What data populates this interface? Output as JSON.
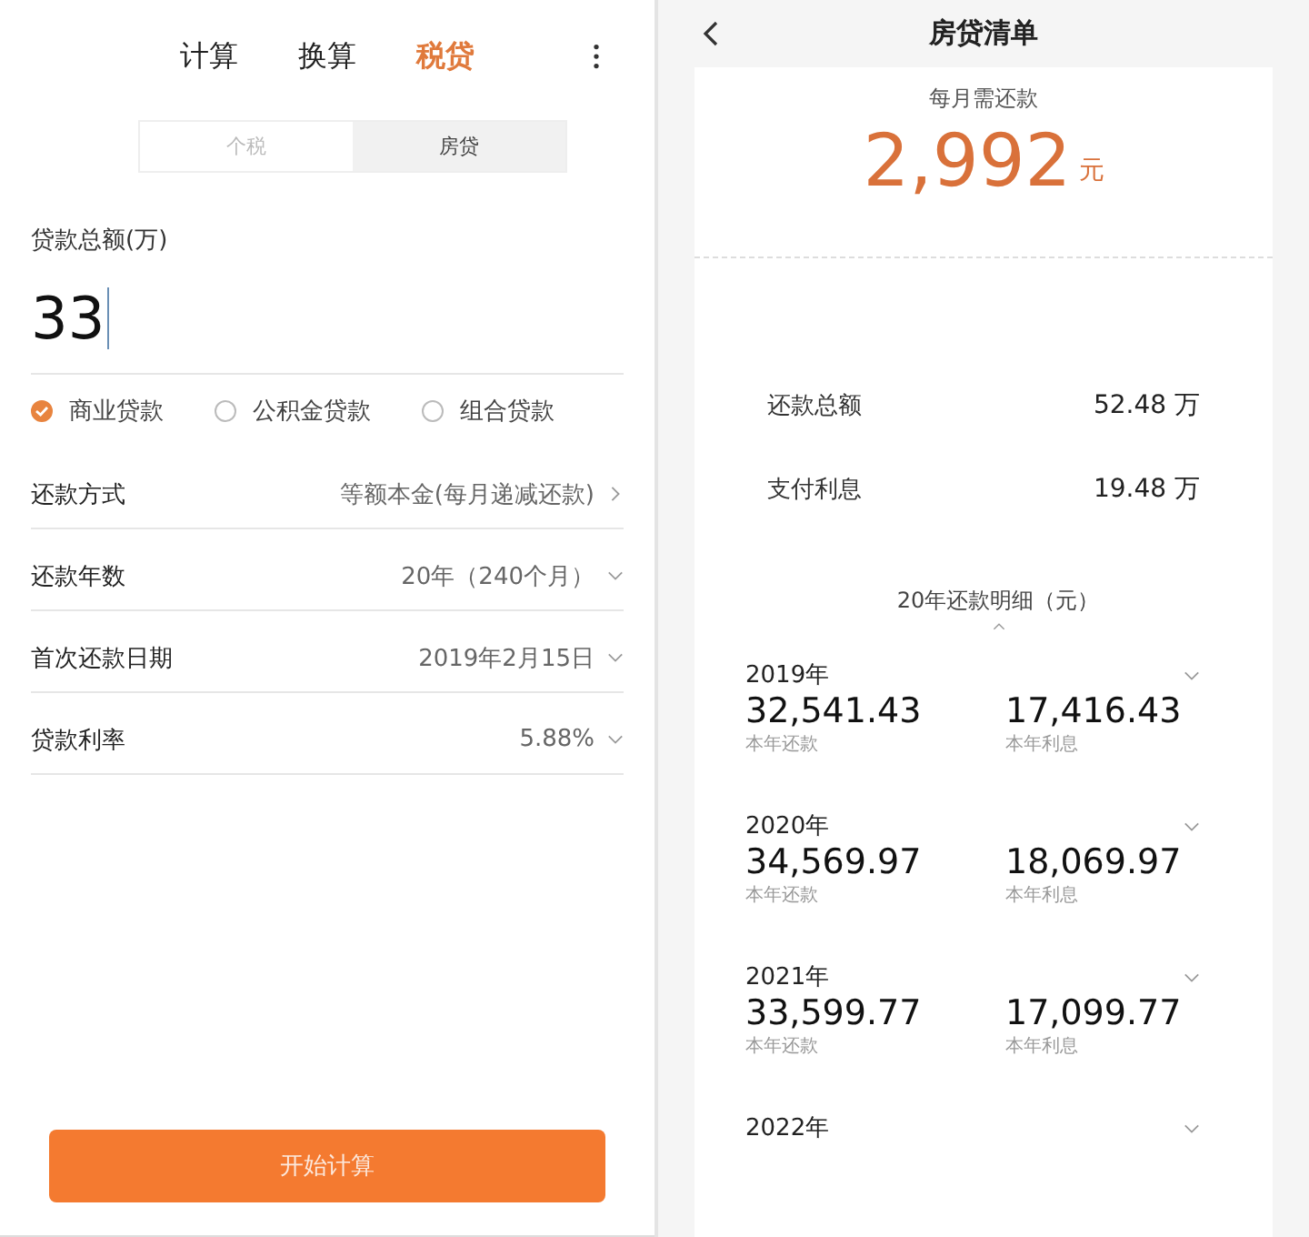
{
  "calculator": {
    "tabs": [
      {
        "label": "计算",
        "selected": false
      },
      {
        "label": "换算",
        "selected": false
      },
      {
        "label": "税贷",
        "selected": true
      }
    ],
    "segments": [
      {
        "label": "个税",
        "selected": false
      },
      {
        "label": "房贷",
        "selected": true
      }
    ],
    "amount": {
      "label": "贷款总额(万)",
      "value": "33"
    },
    "loan_types": [
      {
        "label": "商业贷款",
        "selected": true
      },
      {
        "label": "公积金贷款",
        "selected": false
      },
      {
        "label": "组合贷款",
        "selected": false
      }
    ],
    "settings": [
      {
        "label": "还款方式",
        "value": "等额本金(每月递减还款)",
        "kind": "link"
      },
      {
        "label": "还款年数",
        "value": "20年（240个月）",
        "kind": "dropdown"
      },
      {
        "label": "首次还款日期",
        "value": "2019年2月15日",
        "kind": "dropdown"
      },
      {
        "label": "贷款利率",
        "value": "5.88%",
        "kind": "dropdown"
      }
    ],
    "button": "开始计算"
  },
  "statement": {
    "title": "房贷清单",
    "monthly": {
      "label": "每月需还款",
      "amount": "2,992",
      "unit": "元"
    },
    "totals": [
      {
        "label": "还款总额",
        "value": "52.48 万"
      },
      {
        "label": "支付利息",
        "value": "19.48 万"
      }
    ],
    "detail": {
      "title": "20年还款明细（元）",
      "expanded": true
    },
    "years": [
      {
        "year": "2019年",
        "payment": "32,541.43",
        "payment_label": "本年还款",
        "interest": "17,416.43",
        "interest_label": "本年利息",
        "expanded": false
      },
      {
        "year": "2020年",
        "payment": "34,569.97",
        "payment_label": "本年还款",
        "interest": "18,069.97",
        "interest_label": "本年利息",
        "expanded": false
      },
      {
        "year": "2021年",
        "payment": "33,599.77",
        "payment_label": "本年还款",
        "interest": "17,099.77",
        "interest_label": "本年利息",
        "expanded": false
      },
      {
        "year": "2022年",
        "expanded": false
      }
    ]
  }
}
